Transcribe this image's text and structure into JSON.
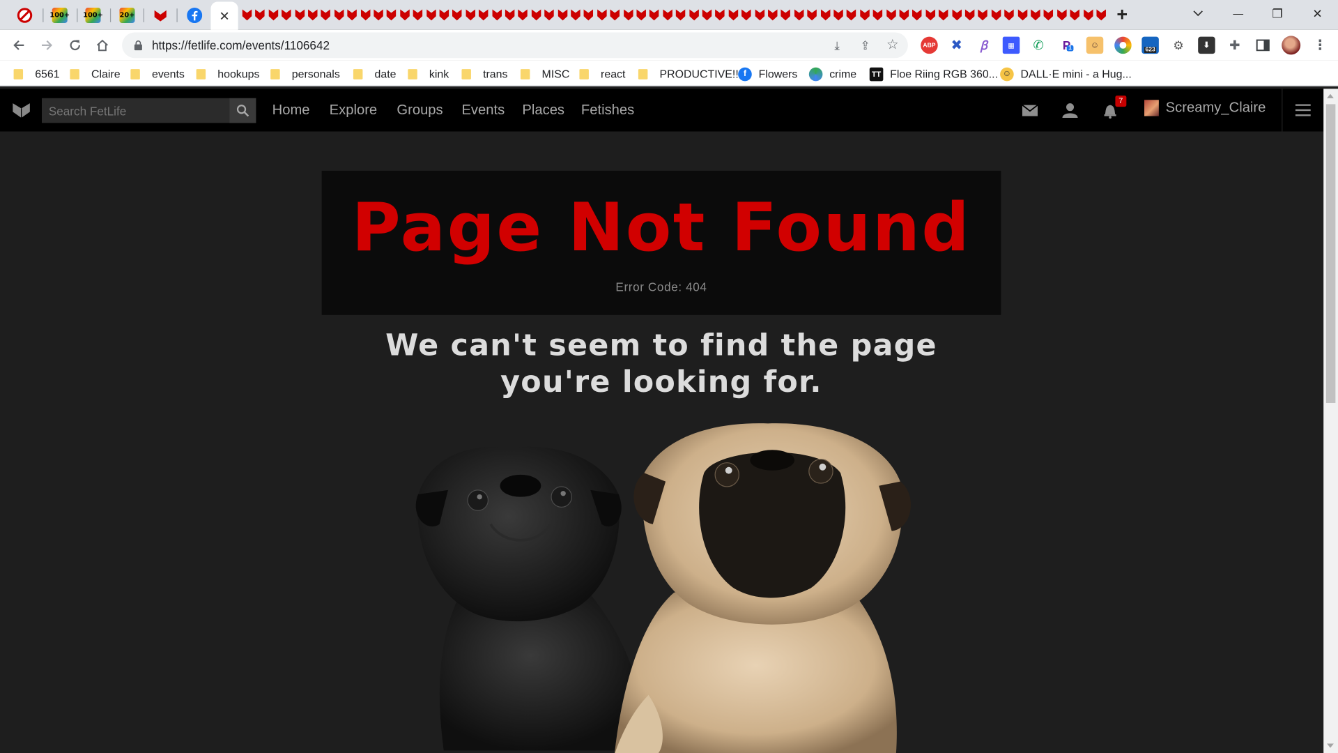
{
  "browser": {
    "tabs": [
      {
        "label": "",
        "icon": "no-sign-icon"
      },
      {
        "label": "100+",
        "icon": "gmail-icon"
      },
      {
        "label": "100+",
        "icon": "gmail-icon"
      },
      {
        "label": "20+",
        "icon": "gmail-icon"
      },
      {
        "label": "",
        "icon": "fetlife-icon"
      },
      {
        "label": "",
        "icon": "facebook-icon"
      },
      {
        "label": "",
        "icon": "close-icon",
        "active": true
      }
    ],
    "new_tab": "+",
    "window_controls": {
      "minimize": "—",
      "restore": "❐",
      "close": "✕"
    },
    "url": "https://fetlife.com/events/1106642",
    "extension_badge": "623",
    "extension_badge_small": "1",
    "bookmarks": [
      {
        "label": "6561",
        "type": "folder"
      },
      {
        "label": "Claire",
        "type": "folder"
      },
      {
        "label": "events",
        "type": "folder"
      },
      {
        "label": "hookups",
        "type": "folder"
      },
      {
        "label": "personals",
        "type": "folder"
      },
      {
        "label": "date",
        "type": "folder"
      },
      {
        "label": "kink",
        "type": "folder"
      },
      {
        "label": "trans",
        "type": "folder"
      },
      {
        "label": "MISC",
        "type": "folder"
      },
      {
        "label": "react",
        "type": "folder"
      },
      {
        "label": "PRODUCTIVE!!",
        "type": "folder"
      },
      {
        "label": "Flowers",
        "type": "facebook"
      },
      {
        "label": "crime",
        "type": "site"
      },
      {
        "label": "Floe Riing RGB 360...",
        "type": "site"
      },
      {
        "label": "DALL·E mini - a Hug...",
        "type": "site"
      }
    ]
  },
  "fetlife": {
    "search_placeholder": "Search FetLife",
    "nav": [
      "Home",
      "Explore",
      "Groups",
      "Events",
      "Places",
      "Fetishes"
    ],
    "notification_count": "7",
    "username": "Screamy_Claire",
    "error": {
      "title": "Page Not Found",
      "code": "Error Code: 404",
      "message": "We can't seem to find the page you're looking for."
    },
    "accent_color": "#d10000"
  }
}
